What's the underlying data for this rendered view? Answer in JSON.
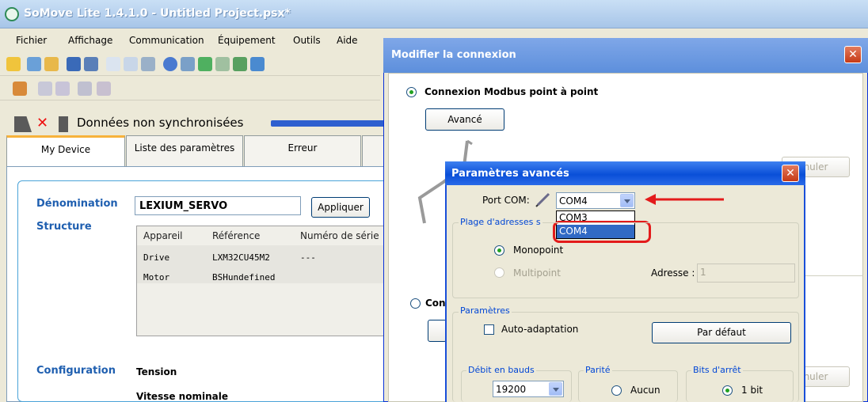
{
  "window": {
    "title": "SoMove Lite 1.4.1.0 - Untitled Project.psx*"
  },
  "menu": [
    "Fichier",
    "Affichage",
    "Communication",
    "Équipement",
    "Outils",
    "Aide"
  ],
  "sync_status": "Données non synchronisées",
  "tabs": [
    "My Device",
    "Liste des paramètres",
    "Erreur"
  ],
  "device": {
    "denomination_label": "Dénomination",
    "denomination_value": "LEXIUM_SERVO",
    "apply_button": "Appliquer",
    "structure_label": "Structure",
    "table": {
      "headers": [
        "Appareil",
        "Référence",
        "Numéro de série"
      ],
      "rows": [
        [
          "Drive",
          "LXM32CU45M2",
          "---"
        ],
        [
          "Motor",
          "BSHundefined",
          ""
        ]
      ]
    },
    "configuration_label": "Configuration",
    "tension_label": "Tension",
    "vitesse_label": "Vitesse nominale"
  },
  "connection_dialog": {
    "title": "Modifier la connexion",
    "modbus_label": "Connexion Modbus point à point",
    "advanced_button": "Avancé",
    "second_option_label": "Con",
    "cancel_partial": "nuler",
    "cancel_partial_2": "nuler"
  },
  "advanced_dialog": {
    "title": "Paramètres avancés",
    "port_label": "Port COM:",
    "port_value": "COM4",
    "port_options": [
      "COM3",
      "COM4"
    ],
    "address_group_label": "Plage d'adresses s",
    "monopoint_label": "Monopoint",
    "multipoint_label": "Multipoint",
    "address_label": "Adresse :",
    "address_value": "1",
    "params_group_label": "Paramètres",
    "auto_adapt_label": "Auto-adaptation",
    "default_button": "Par défaut",
    "baud_group_label": "Débit en bauds",
    "baud_value": "19200",
    "parity_group_label": "Parité",
    "parity_option": "Aucun",
    "stop_bits_group_label": "Bits d'arrêt",
    "stop_bits_option": "1 bit"
  },
  "colors": {
    "highlight": "#316ac5",
    "annotation": "#e31b1b",
    "title_bar": "#0a4fd8"
  }
}
